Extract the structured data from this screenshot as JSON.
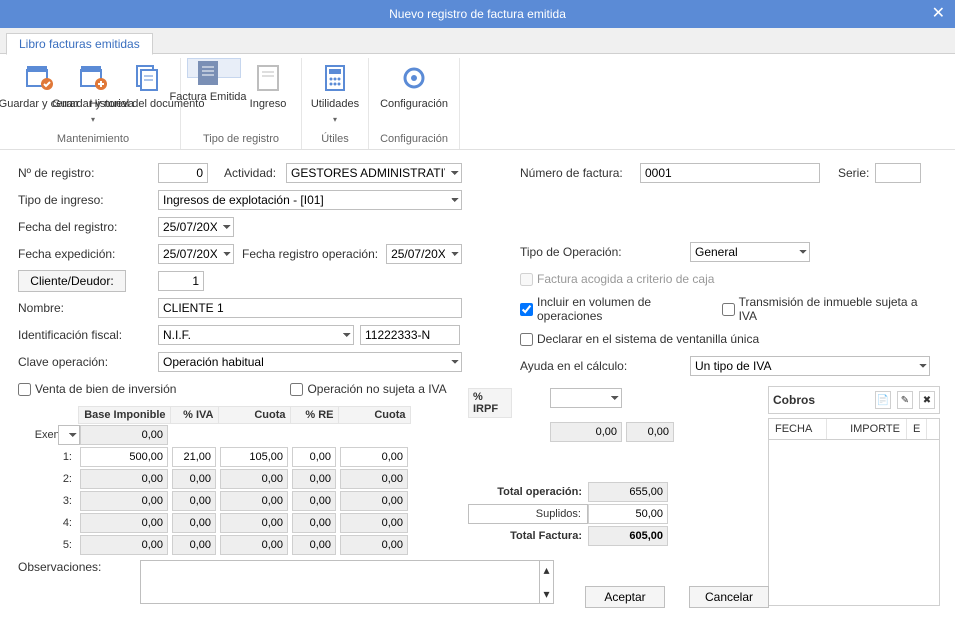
{
  "window": {
    "title": "Nuevo registro de factura emitida"
  },
  "tab": {
    "label": "Libro facturas emitidas"
  },
  "ribbon": {
    "save_close": "Guardar y cerrar",
    "save_new": "Guardar y nueva",
    "history": "Historial del documento",
    "invoice": "Factura Emitida",
    "income": "Ingreso",
    "utilities": "Utilidades",
    "config": "Configuración",
    "group_maint": "Mantenimiento",
    "group_regtype": "Tipo de registro",
    "group_utils": "Útiles",
    "group_config": "Configuración"
  },
  "form": {
    "reg_no_label": "Nº de registro:",
    "reg_no": "0",
    "activity_label": "Actividad:",
    "activity": "GESTORES ADMINISTRATIVOS",
    "invoice_no_label": "Número de factura:",
    "invoice_no": "0001",
    "serie_label": "Serie:",
    "serie": "",
    "income_type_label": "Tipo de ingreso:",
    "income_type": "Ingresos de explotación - [I01]",
    "reg_date_label": "Fecha del registro:",
    "reg_date": "25/07/20XX",
    "issue_date_label": "Fecha expedición:",
    "issue_date": "25/07/20XX",
    "op_reg_date_label": "Fecha registro operación:",
    "op_reg_date": "25/07/20XX",
    "client_btn": "Cliente/Deudor:",
    "client_no": "1",
    "name_label": "Nombre:",
    "name": "CLIENTE 1",
    "fiscal_id_label": "Identificación fiscal:",
    "fiscal_id_type": "N.I.F.",
    "fiscal_id": "11222333-N",
    "op_key_label": "Clave operación:",
    "op_key": "Operación habitual",
    "chk_invest": "Venta de bien de inversión",
    "chk_no_iva": "Operación no sujeta a IVA",
    "op_type_label": "Tipo de Operación:",
    "op_type": "General",
    "chk_cash": "Factura acogida a criterio de caja",
    "chk_vol": "Incluir en  volumen de operaciones",
    "chk_transm": "Transmisión de inmueble sujeta a IVA",
    "chk_oss": "Declarar en el sistema de ventanilla única",
    "calc_help_label": "Ayuda en el cálculo:",
    "calc_help": "Un tipo de IVA"
  },
  "grid": {
    "headers": {
      "base": "Base Imponible",
      "iva_pct": "% IVA",
      "cuota": "Cuota",
      "re_pct": "% RE",
      "cuota2": "Cuota",
      "irpf_pct": "% IRPF"
    },
    "exenta_label": "Exenta:",
    "exenta_base": "0,00",
    "rows": [
      {
        "n": "1:",
        "base": "500,00",
        "iva": "21,00",
        "cuota": "105,00",
        "re": "0,00",
        "cuota2": "0,00"
      },
      {
        "n": "2:",
        "base": "0,00",
        "iva": "0,00",
        "cuota": "0,00",
        "re": "0,00",
        "cuota2": "0,00"
      },
      {
        "n": "3:",
        "base": "0,00",
        "iva": "0,00",
        "cuota": "0,00",
        "re": "0,00",
        "cuota2": "0,00"
      },
      {
        "n": "4:",
        "base": "0,00",
        "iva": "0,00",
        "cuota": "0,00",
        "re": "0,00",
        "cuota2": "0,00"
      },
      {
        "n": "5:",
        "base": "0,00",
        "iva": "0,00",
        "cuota": "0,00",
        "re": "0,00",
        "cuota2": "0,00"
      }
    ],
    "irpf_sel": "",
    "irpf_base": "0,00",
    "irpf_cuota": "0,00"
  },
  "totals": {
    "op_label": "Total operación:",
    "op": "655,00",
    "supl_label": "Suplidos:",
    "supl": "50,00",
    "fact_label": "Total Factura:",
    "fact": "605,00"
  },
  "cobros": {
    "title": "Cobros",
    "col_fecha": "FECHA",
    "col_importe": "IMPORTE",
    "col_e": "E"
  },
  "obs": {
    "label": "Observaciones:",
    "value": ""
  },
  "actions": {
    "ok": "Aceptar",
    "cancel": "Cancelar"
  }
}
